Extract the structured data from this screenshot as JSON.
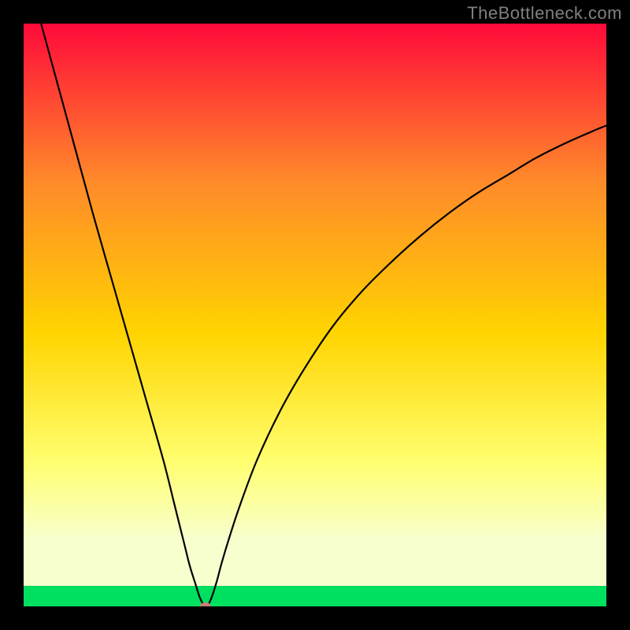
{
  "watermark": "TheBottleneck.com",
  "chart_data": {
    "type": "line",
    "title": "",
    "xlabel": "",
    "ylabel": "",
    "xlim": [
      0,
      100
    ],
    "ylim": [
      0,
      100
    ],
    "background_gradient": {
      "top": "#ff0a3a",
      "mid_upper": "#ff8a2a",
      "mid": "#ffd400",
      "mid_lower": "#ffff70",
      "low": "#f7ffcf",
      "bottom": "#00e060"
    },
    "gradient_band_top_fraction": 0.035,
    "series": [
      {
        "name": "bottleneck-curve",
        "color": "#000000",
        "x": [
          3,
          6,
          9,
          12,
          15,
          18,
          21,
          24,
          26,
          27.5,
          28.5,
          29.5,
          30.2,
          30.8,
          31.2,
          31.6,
          32,
          32.5,
          33.2,
          34,
          35.2,
          37,
          40,
          44,
          48,
          53,
          58,
          63,
          68,
          73,
          78,
          83,
          88,
          93,
          98,
          100
        ],
        "y": [
          100,
          89,
          78,
          67,
          56.5,
          46,
          35.5,
          25,
          17,
          11,
          7,
          3.8,
          1.6,
          0.4,
          0,
          0.2,
          0.9,
          2.2,
          4.5,
          7.5,
          11.5,
          17,
          25,
          33.5,
          40.5,
          48,
          54,
          59,
          63.5,
          67.5,
          71,
          74,
          77,
          79.5,
          81.7,
          82.5
        ]
      }
    ],
    "marker": {
      "name": "min-point",
      "x": 31.2,
      "y": 0,
      "color": "#c97a78",
      "rx": 7,
      "ry": 5
    }
  }
}
